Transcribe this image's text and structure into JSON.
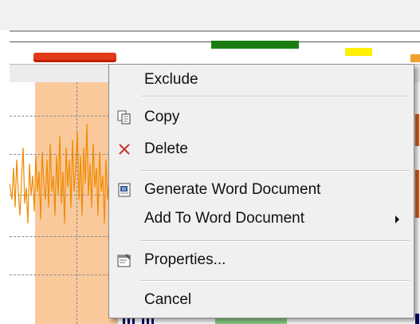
{
  "context_menu": {
    "items": [
      {
        "label": "Exclude",
        "icon": null
      },
      {
        "label": "Copy",
        "icon": "copy-icon"
      },
      {
        "label": "Delete",
        "icon": "delete-x-icon"
      },
      {
        "label": "Generate Word Document",
        "icon": "word-document-icon"
      },
      {
        "label": "Add To Word Document",
        "icon": null,
        "submenu": true
      },
      {
        "label": "Properties...",
        "icon": "properties-icon"
      },
      {
        "label": "Cancel",
        "icon": null
      }
    ]
  },
  "colors": {
    "event_red": "#e03a17",
    "event_green": "#1a7d14",
    "event_yellow": "#ffef00",
    "region_orange": "#f9c99c",
    "signal_orange": "#f08a00",
    "menu_background": "#f0f0f0",
    "delete_icon": "#c0392b"
  }
}
